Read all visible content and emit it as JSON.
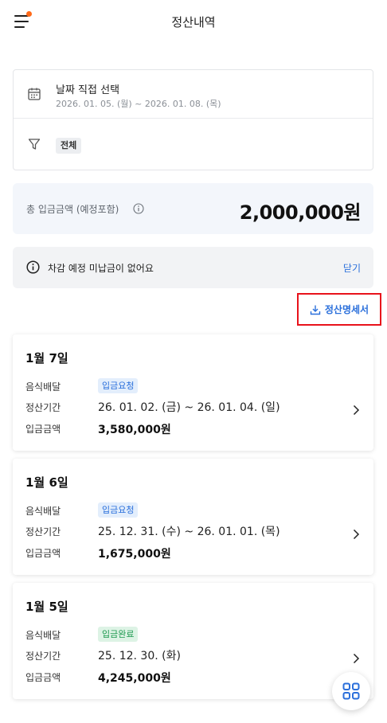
{
  "header": {
    "title": "정산내역"
  },
  "filter": {
    "date_title": "날짜 직접 선택",
    "date_range": "2026. 01. 05. (월) ~ 2026. 01. 08. (목)",
    "type_value": "전체"
  },
  "total": {
    "label": "총 입금금액 (예정포함)",
    "amount": "2,000,000원"
  },
  "notice": {
    "text": "차감 예정 미납금이 없어요",
    "close_label": "닫기"
  },
  "statement_button": {
    "label": "정산명세서"
  },
  "cards": [
    {
      "date": "1월 7일",
      "service_label": "음식배달",
      "status": "입금요청",
      "period_label": "정산기간",
      "period": "26. 01. 02. (금) ~ 26. 01. 04. (일)",
      "amount_label": "입금금액",
      "amount": "3,580,000원"
    },
    {
      "date": "1월 6일",
      "service_label": "음식배달",
      "status": "입금요청",
      "period_label": "정산기간",
      "period": "25. 12. 31. (수) ~ 26. 01. 01. (목)",
      "amount_label": "입금금액",
      "amount": "1,675,000원"
    },
    {
      "date": "1월 5일",
      "service_label": "음식배달",
      "status": "입금완료",
      "period_label": "정산기간",
      "period": "25. 12. 30. (화)",
      "amount_label": "입금금액",
      "amount": "4,245,000원"
    }
  ],
  "colors": {
    "accent_blue": "#2a6fdb",
    "status_requested": "#2a6fdb",
    "status_completed": "#1e9a50",
    "notification_dot": "#ff6a1a",
    "highlight_border": "#e8121b"
  },
  "icons": [
    "menu-icon",
    "calendar-icon",
    "filter-icon",
    "info-icon",
    "download-icon",
    "chevron-right-icon",
    "grid-icon"
  ]
}
